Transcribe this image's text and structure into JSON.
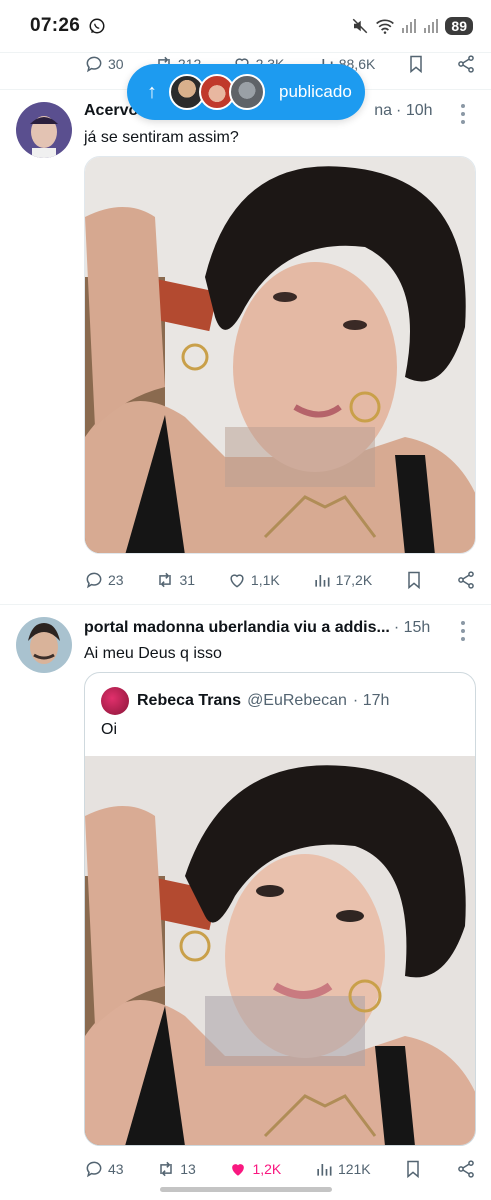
{
  "status_bar": {
    "time": "07:26",
    "battery": "89"
  },
  "top_tweet_actions": {
    "replies": "30",
    "retweets": "212",
    "likes": "2,3K",
    "views": "88,6K"
  },
  "published_pill": {
    "label": "publicado"
  },
  "tweet1": {
    "name": "Acervo",
    "handle_fragment": "na",
    "time": "· 10h",
    "text": "já se sentiram assim?",
    "actions": {
      "replies": "23",
      "retweets": "31",
      "likes": "1,1K",
      "views": "17,2K"
    }
  },
  "tweet2": {
    "name": "portal madonna uberlandia viu a addis...",
    "time": "· 15h",
    "text": "Ai meu Deus q isso",
    "quote": {
      "name": "Rebeca Trans",
      "handle": "@EuRebecan",
      "time": "· 17h",
      "text": "Oi"
    },
    "actions": {
      "replies": "43",
      "retweets": "13",
      "likes": "1,2K",
      "views": "121K",
      "liked": true
    }
  },
  "colors": {
    "accent": "#1d9bf0",
    "like": "#f91880",
    "muted": "#536471"
  }
}
